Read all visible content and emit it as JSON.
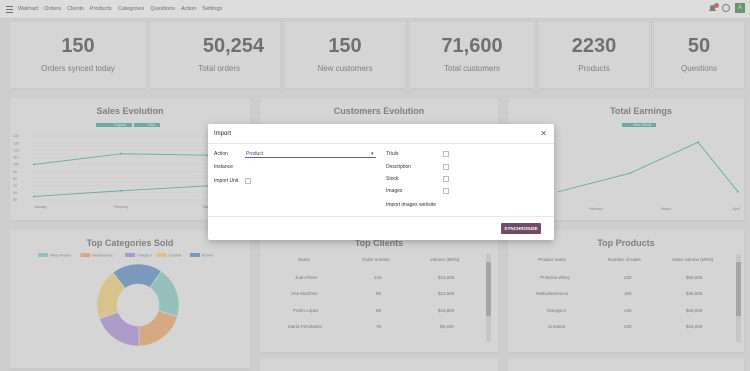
{
  "topbar": {
    "brand": "Walmart",
    "nav": [
      "Orders",
      "Clients",
      "Products",
      "Categories",
      "Questions",
      "Action",
      "Settings"
    ],
    "avatar_letter": "A"
  },
  "kpis": [
    {
      "value": "150",
      "label": "Orders synced today"
    },
    {
      "value": "50,254",
      "label": "Total orders"
    },
    {
      "value": "150",
      "label": "New customers"
    },
    {
      "value": "71,600",
      "label": "Total customers"
    },
    {
      "value": "2230",
      "label": "Products"
    },
    {
      "value": "50",
      "label": "Questions"
    }
  ],
  "charts": {
    "sales_title": "Sales Evolution",
    "sales_legend": [
      "Organic",
      "Paid"
    ],
    "sales_y_ticks": [
      "140",
      "130",
      "120",
      "110",
      "100",
      "90",
      "80",
      "70",
      "60",
      "50"
    ],
    "sales_x_ticks": [
      "January",
      "February",
      "March"
    ],
    "customers_title": "Customers Evolution",
    "earnings_title": "Total Earnings",
    "earnings_legend": [
      "New Clients"
    ],
    "earnings_x_ticks": [
      "February",
      "March",
      "April"
    ],
    "categories_title": "Top Categories Sold",
    "categories_legend": [
      "Whey Protein",
      "Multivitamins",
      "Omega-3",
      "Creatine",
      "BCAAs"
    ],
    "clients_title": "Top Clients",
    "products_title": "Top Products"
  },
  "chart_data": [
    {
      "type": "line",
      "title": "Sales Evolution",
      "categories": [
        "January",
        "February",
        "March"
      ],
      "ylim": [
        50,
        140
      ],
      "series": [
        {
          "name": "Organic",
          "values": [
            100,
            115,
            113
          ]
        },
        {
          "name": "Paid",
          "values": [
            55,
            63,
            70
          ]
        }
      ]
    },
    {
      "type": "line",
      "title": "Total Earnings",
      "categories": [
        "February",
        "March",
        "April"
      ],
      "series": [
        {
          "name": "New Clients",
          "values": [
            40,
            90,
            10
          ]
        }
      ]
    },
    {
      "type": "pie",
      "title": "Top Categories Sold",
      "categories": [
        "Whey Protein",
        "Multivitamins",
        "Omega-3",
        "Creatine",
        "BCAAs"
      ],
      "values": [
        20,
        20,
        20,
        20,
        20
      ]
    }
  ],
  "colors": {
    "teal": "#2fa39a",
    "whey": "#7ecac4",
    "multi": "#f0a15a",
    "omega": "#a889d8",
    "creatine": "#f3d26b",
    "bcaa": "#4a86c5",
    "accent": "#714b67"
  },
  "top_clients": {
    "headers": [
      "Name",
      "Order number",
      "Volume (MXN)"
    ],
    "rows": [
      [
        "Juan Pérez",
        "120",
        "$15,000"
      ],
      [
        "Ana Martínez",
        "95",
        "$12,500"
      ],
      [
        "Pedro López",
        "88",
        "$10,800"
      ],
      [
        "María Fernández",
        "76",
        "$9,400"
      ]
    ]
  },
  "top_products": {
    "headers": [
      "Product name",
      "Number of sales",
      "Sales volume (MXN)"
    ],
    "rows": [
      [
        "Proteína Whey",
        "230",
        "$50,000"
      ],
      [
        "Multivitamínicos",
        "180",
        "$36,000"
      ],
      [
        "Omega-3",
        "140",
        "$28,000"
      ],
      [
        "Creatina",
        "220",
        "$44,000"
      ]
    ]
  },
  "modal": {
    "title": "Import",
    "action_label": "Action",
    "action_value": "Product",
    "instance_label": "Instance",
    "import_unit_label": "Import Unit",
    "titulo_label": "Título",
    "description_label": "Description",
    "stock_label": "Stock",
    "images_label": "Images",
    "import_images_website_label": "Import images website",
    "sync_label": "SYNCHRONIZE"
  }
}
